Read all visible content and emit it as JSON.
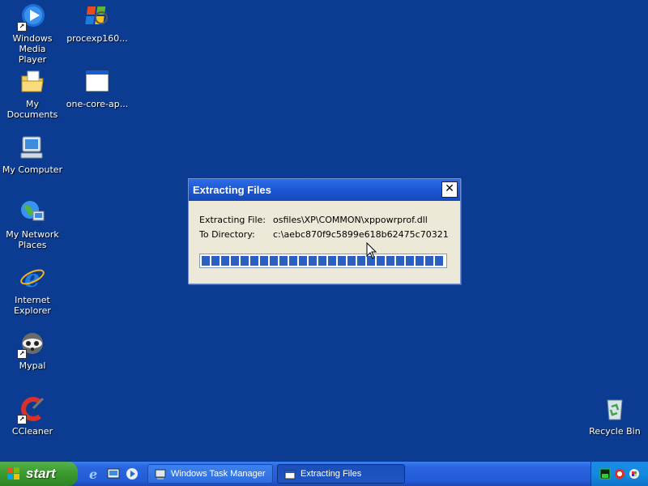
{
  "desktop": {
    "icons": [
      {
        "label": "Windows Media\nPlayer",
        "icon": "media-player-icon"
      },
      {
        "label": "procexp160...",
        "icon": "procexp-icon"
      },
      {
        "label": "My Documents",
        "icon": "my-documents-icon"
      },
      {
        "label": "one-core-ap...",
        "icon": "window-icon"
      },
      {
        "label": "My Computer",
        "icon": "my-computer-icon"
      },
      {
        "label": "My Network\nPlaces",
        "icon": "network-places-icon"
      },
      {
        "label": "Internet\nExplorer",
        "icon": "internet-explorer-icon"
      },
      {
        "label": "Mypal",
        "icon": "mypal-icon"
      },
      {
        "label": "CCleaner",
        "icon": "ccleaner-icon"
      },
      {
        "label": "Recycle Bin",
        "icon": "recycle-bin-icon"
      }
    ]
  },
  "dialog": {
    "title": "Extracting Files",
    "close_symbol": "✕",
    "extracting_label": "Extracting File:",
    "extracting_value": "osfiles\\XP\\COMMON\\xppowrprof.dll",
    "directory_label": "To Directory:",
    "directory_value": "c:\\aebc870f9c5899e618b62475c70321",
    "progress_percent": 100
  },
  "taskbar": {
    "start_label": "start",
    "tasks": [
      {
        "label": "Windows Task Manager",
        "icon": "task-manager-icon"
      },
      {
        "label": "Extracting Files",
        "icon": "window-icon"
      }
    ]
  },
  "colors": {
    "desktop": "#0c3c91",
    "taskbar": "#235ad6",
    "start": "#3a9a2e",
    "titlebar": "#1c59d6",
    "progress_fill": "#2b5fc4"
  }
}
